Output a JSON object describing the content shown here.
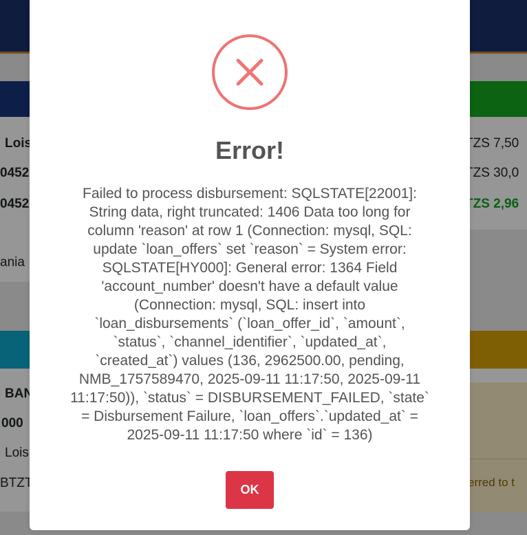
{
  "background": {
    "left_card_top": {
      "line_1": "Lois",
      "line_2": "0452",
      "line_3": "0452",
      "line_4": "ania"
    },
    "right_card_top": {
      "line_1": "TZS 7,50",
      "line_2": "TZS 30,0",
      "line_3": "TZS 2,96"
    },
    "left_card_bottom": {
      "line_1": "BAN",
      "line_2": "000",
      "line_3": "Lois",
      "line_4": "BTZT"
    },
    "right_card_bottom": {
      "line_1": "erred to t"
    }
  },
  "dialog": {
    "icon": "error-x-icon",
    "icon_color": "#f27474",
    "title": "Error!",
    "message_lines": [
      "Failed to process disbursement: SQLSTATE[22001]:",
      "String data, right truncated: 1406 Data too long for",
      "column 'reason' at row 1 (Connection: mysql, SQL:",
      "update `loan_offers` set `reason` = System error:",
      "SQLSTATE[HY000]: General error: 1364 Field",
      "'account_number' doesn't have a default value",
      "(Connection: mysql, SQL: insert into",
      "`loan_disbursements` (`loan_offer_id`, `amount`,",
      "`status`, `channel_identifier`, `updated_at`,",
      "`created_at`) values (136, 2962500.00, pending,",
      "NMB_1757589470, 2025-09-11 11:17:50, 2025-09-11",
      "11:17:50)), `status` = DISBURSEMENT_FAILED, `state`",
      "= Disbursement Failure, `loan_offers`.`updated_at` =",
      "2025-09-11 11:17:50 where `id` = 136)"
    ],
    "ok_label": "OK",
    "ok_color": "#dc3545"
  }
}
